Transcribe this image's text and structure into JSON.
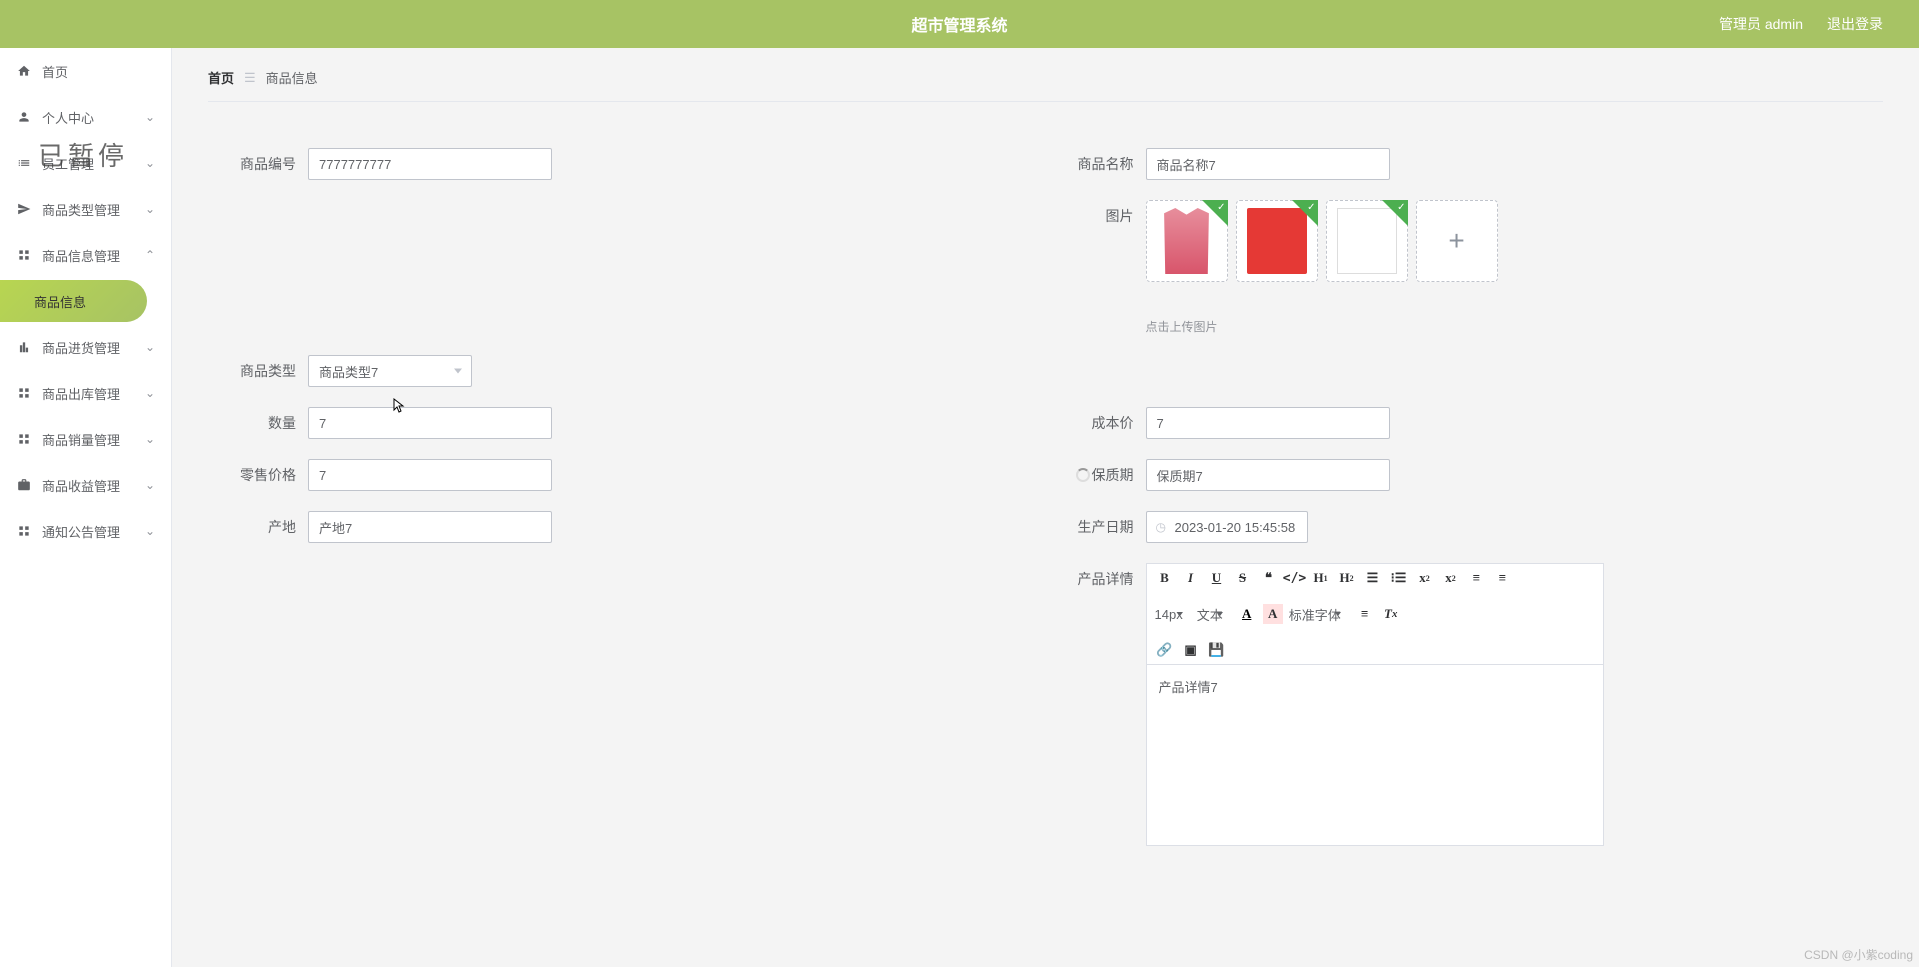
{
  "header": {
    "title": "超市管理系统",
    "admin_label": "管理员 admin",
    "logout_label": "退出登录"
  },
  "watermark": "已暂停",
  "sidebar": {
    "items": [
      {
        "label": "首页",
        "iconName": "home-icon",
        "expandable": false
      },
      {
        "label": "个人中心",
        "iconName": "user-icon",
        "expandable": true,
        "collapsed": true
      },
      {
        "label": "员工管理",
        "iconName": "list-icon",
        "expandable": true,
        "collapsed": true
      },
      {
        "label": "商品类型管理",
        "iconName": "send-icon",
        "expandable": true,
        "collapsed": true
      },
      {
        "label": "商品信息管理",
        "iconName": "grid-icon",
        "expandable": true,
        "collapsed": false
      },
      {
        "label": "商品进货管理",
        "iconName": "bar-icon",
        "expandable": true,
        "collapsed": true
      },
      {
        "label": "商品出库管理",
        "iconName": "grid-icon",
        "expandable": true,
        "collapsed": true
      },
      {
        "label": "商品销量管理",
        "iconName": "grid-icon",
        "expandable": true,
        "collapsed": true
      },
      {
        "label": "商品收益管理",
        "iconName": "briefcase-icon",
        "expandable": true,
        "collapsed": true
      },
      {
        "label": "通知公告管理",
        "iconName": "grid-icon",
        "expandable": true,
        "collapsed": true
      }
    ],
    "active_submenu": "商品信息"
  },
  "breadcrumb": {
    "home": "首页",
    "current": "商品信息"
  },
  "form": {
    "product_no": {
      "label": "商品编号",
      "value": "7777777777"
    },
    "product_name": {
      "label": "商品名称",
      "value": "商品名称7"
    },
    "images": {
      "label": "图片",
      "hint": "点击上传图片"
    },
    "product_type": {
      "label": "商品类型",
      "value": "商品类型7"
    },
    "quantity": {
      "label": "数量",
      "value": "7"
    },
    "cost_price": {
      "label": "成本价",
      "value": "7"
    },
    "retail_price": {
      "label": "零售价格",
      "value": "7"
    },
    "shelf_life": {
      "label": "保质期",
      "value": "保质期7"
    },
    "origin": {
      "label": "产地",
      "value": "产地7"
    },
    "prod_date": {
      "label": "生产日期",
      "value": "2023-01-20 15:45:58"
    },
    "detail": {
      "label": "产品详情",
      "value": "产品详情7"
    }
  },
  "editor": {
    "font_size": "14px",
    "style_label": "文本",
    "font_family": "标准字体"
  },
  "footer_mark": "CSDN @小紫coding"
}
